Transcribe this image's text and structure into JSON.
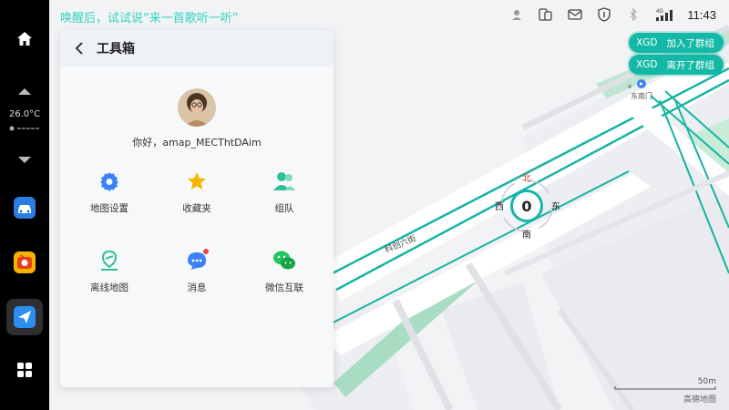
{
  "voice_hint": "唤醒后，试试说“来一首歌听一听”",
  "status": {
    "network": "4G",
    "time": "11:43"
  },
  "dock": {
    "temperature": "26.0°C"
  },
  "group_notifications": [
    {
      "user": "XGD",
      "message": "加入了群组"
    },
    {
      "user": "XGD",
      "message": "离开了群组"
    }
  ],
  "panel": {
    "title": "工具箱",
    "greeting": "你好，amap_MECThtDAim",
    "tools": [
      {
        "label": "地图设置",
        "icon": "gear-icon"
      },
      {
        "label": "收藏夹",
        "icon": "star-icon"
      },
      {
        "label": "组队",
        "icon": "team-icon"
      },
      {
        "label": "离线地图",
        "icon": "offline-map-icon"
      },
      {
        "label": "消息",
        "icon": "message-icon"
      },
      {
        "label": "微信互联",
        "icon": "wechat-icon"
      }
    ]
  },
  "compass": {
    "north": "北",
    "south": "南",
    "east": "东",
    "west": "西",
    "speed": "0"
  },
  "map": {
    "street": "科创六街",
    "poi": "东南门",
    "scale": "50m",
    "brand": "高德地图"
  },
  "colors": {
    "accent": "#14b8a6",
    "road_green": "#a8dcc3",
    "panel_bg": "#f7f8fa"
  }
}
